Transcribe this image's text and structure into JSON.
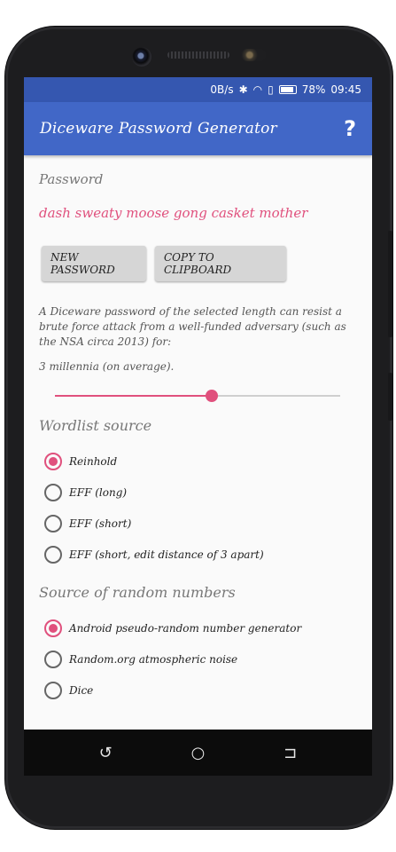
{
  "status_bar": {
    "network_speed": "0B/s",
    "battery": "78%",
    "time": "09:45",
    "icons": [
      "bluetooth-icon",
      "wifi-icon",
      "sim-icon",
      "battery-icon"
    ]
  },
  "toolbar": {
    "title": "Diceware Password Generator",
    "help_label": "?"
  },
  "password": {
    "label": "Password",
    "value": "dash sweaty moose gong casket mother"
  },
  "buttons": {
    "new_password": "NEW PASSWORD",
    "copy_to_clipboard": "COPY TO CLIPBOARD"
  },
  "strength": {
    "description": "A Diceware password of the selected length can resist a brute force attack from a well-funded adversary (such as the NSA circa 2013) for:",
    "duration": "3 millennia (on average).",
    "slider_fraction": 0.55
  },
  "wordlist": {
    "title": "Wordlist source",
    "options": [
      {
        "label": "Reinhold",
        "checked": true
      },
      {
        "label": "EFF (long)",
        "checked": false
      },
      {
        "label": "EFF (short)",
        "checked": false
      },
      {
        "label": "EFF (short, edit distance of 3 apart)",
        "checked": false
      }
    ]
  },
  "random_source": {
    "title": "Source of random numbers",
    "options": [
      {
        "label": "Android pseudo-random number generator",
        "checked": true
      },
      {
        "label": "Random.org atmospheric noise",
        "checked": false
      },
      {
        "label": "Dice",
        "checked": false
      }
    ]
  },
  "navbar": {
    "icons": [
      "back-icon",
      "home-icon",
      "recents-icon"
    ]
  },
  "colors": {
    "primary": "#4167c7",
    "status_bar": "#3557b0",
    "accent": "#e0507d"
  }
}
